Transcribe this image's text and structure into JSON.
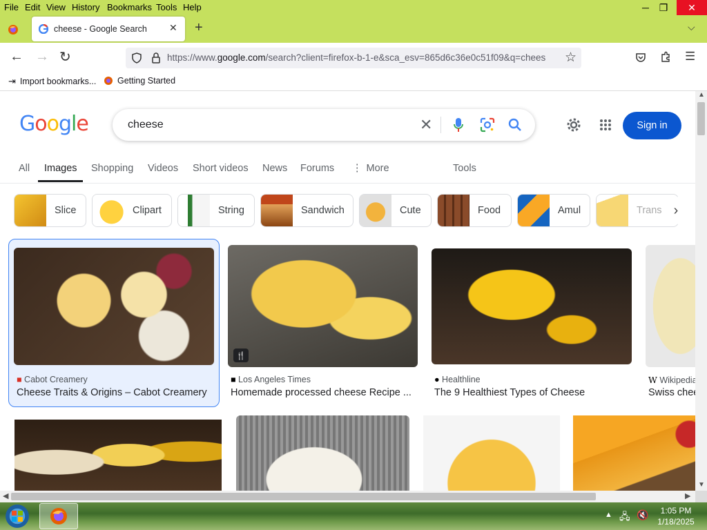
{
  "menu": {
    "items": [
      "File",
      "Edit",
      "View",
      "History",
      "Bookmarks",
      "Tools",
      "Help"
    ]
  },
  "tab": {
    "title": "cheese - Google Search"
  },
  "url": {
    "prefix": "https://www.",
    "domain": "google.com",
    "rest": "/search?client=firefox-b-1-e&sca_esv=865d6c36e0c51f09&q=chees"
  },
  "bookmarks": {
    "import": "Import bookmarks...",
    "getting_started": "Getting Started"
  },
  "google": {
    "logo": "Google",
    "query": "cheese",
    "sign_in": "Sign in",
    "tabs": [
      "All",
      "Images",
      "Shopping",
      "Videos",
      "Short videos",
      "News",
      "Forums",
      "More"
    ],
    "tools": "Tools",
    "chips": [
      "Slice",
      "Clipart",
      "String",
      "Sandwich",
      "Cute",
      "Food",
      "Amul",
      "Trans"
    ]
  },
  "results": [
    {
      "source": "Cabot Creamery",
      "title": "Cheese Traits & Origins – Cabot Creamery"
    },
    {
      "source": "Los Angeles Times",
      "title": "Homemade processed cheese Recipe ..."
    },
    {
      "source": "Healthline",
      "title": "The 9 Healthiest Types of Cheese"
    },
    {
      "source": "Wikipedia",
      "title": "Swiss chee"
    }
  ],
  "clock": {
    "time": "1:05 PM",
    "date": "1/18/2025"
  },
  "colors": {
    "chrome": "#c5e05e",
    "google_blue": "#0b57d0",
    "selected_card": "#e8f0fe"
  }
}
